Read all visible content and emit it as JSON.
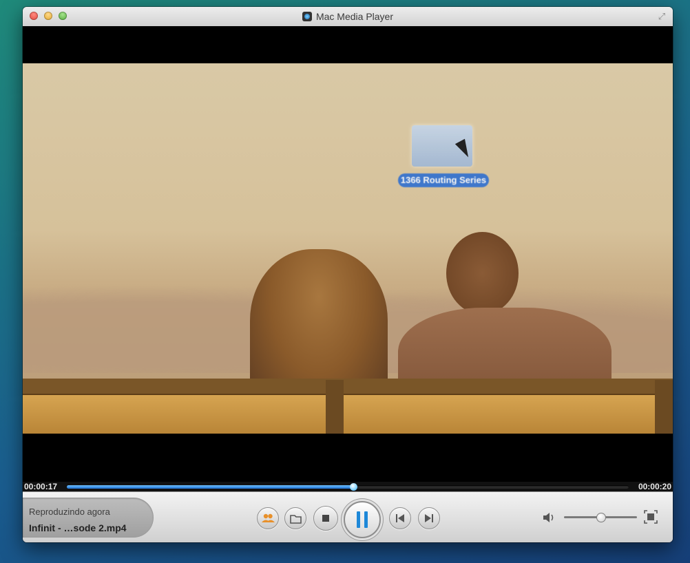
{
  "window": {
    "title": "Mac Media Player",
    "fullscreen_icon": "expand-arrows-icon"
  },
  "video": {
    "desktop_folder_label": "1366 Routing Series",
    "desktop_folder_icon": "folder-icon",
    "cursor_icon": "mouse-pointer-icon"
  },
  "progress": {
    "elapsed": "00:00:17",
    "total": "00:00:20",
    "played_fraction": 0.51
  },
  "now_playing": {
    "label": "Reproduzindo agora",
    "file": "Infinit - …sode 2.mp4"
  },
  "controls": {
    "share_icon": "people-share-icon",
    "open_icon": "folder-open-icon",
    "stop_icon": "stop-icon",
    "play_state": "playing",
    "pause_icon": "pause-icon",
    "prev_icon": "skip-previous-icon",
    "next_icon": "skip-next-icon",
    "volume_icon": "speaker-icon",
    "volume_level": 0.5,
    "fullscreen_icon": "fullscreen-icon"
  },
  "colors": {
    "progress_fill": "#1e6fd0",
    "play_button_accent": "#1e88d8"
  }
}
